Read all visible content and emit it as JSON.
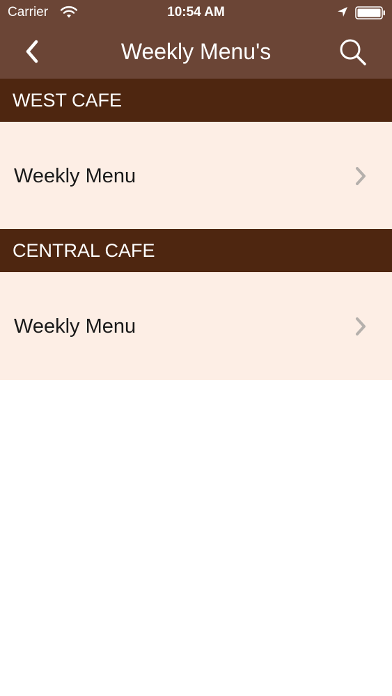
{
  "status_bar": {
    "carrier": "Carrier",
    "time": "10:54 AM",
    "icons": [
      "wifi-icon",
      "location-arrow-icon",
      "battery-icon"
    ]
  },
  "nav": {
    "title": "Weekly Menu's",
    "back_icon": "chevron-left-icon",
    "search_icon": "search-icon"
  },
  "sections": [
    {
      "header": "WEST CAFE",
      "items": [
        {
          "label": "Weekly Menu",
          "icon": "chevron-right-icon"
        }
      ]
    },
    {
      "header": "CENTRAL CAFE",
      "items": [
        {
          "label": "Weekly Menu",
          "icon": "chevron-right-icon"
        }
      ]
    }
  ],
  "colors": {
    "nav_background": "#6b4536",
    "section_header_background": "#4e2610",
    "row_background": "#fdeee5",
    "chevron": "#b5b0ac"
  }
}
